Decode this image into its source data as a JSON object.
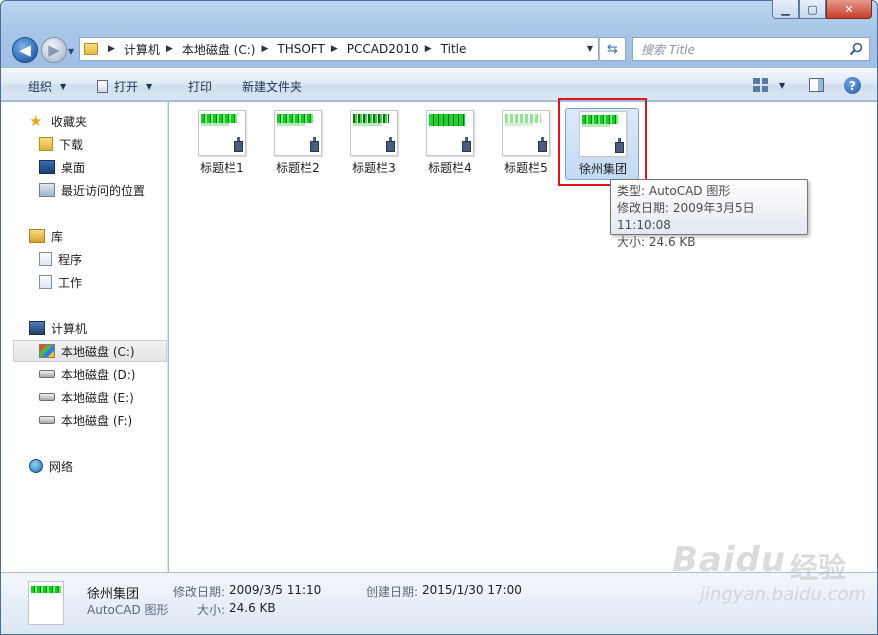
{
  "window": {
    "controls": {
      "minimize": "▁",
      "maximize": "▢",
      "close": "✕"
    }
  },
  "address": {
    "crumbs": [
      "计算机",
      "本地磁盘 (C:)",
      "THSOFT",
      "PCCAD2010",
      "Title"
    ]
  },
  "search": {
    "placeholder": "搜索 Title"
  },
  "toolbar": {
    "organize": "组织",
    "open": "打开",
    "print": "打印",
    "new_folder": "新建文件夹"
  },
  "nav": {
    "favorites": {
      "label": "收藏夹",
      "items": [
        {
          "label": "下载",
          "icon": "download-folder-icon"
        },
        {
          "label": "桌面",
          "icon": "desktop-icon"
        },
        {
          "label": "最近访问的位置",
          "icon": "recent-places-icon"
        }
      ]
    },
    "libraries": {
      "label": "库",
      "items": [
        {
          "label": "程序",
          "icon": "library-doc-icon"
        },
        {
          "label": "工作",
          "icon": "library-doc-icon"
        }
      ]
    },
    "computer": {
      "label": "计算机",
      "items": [
        {
          "label": "本地磁盘 (C:)",
          "icon": "windows-drive-icon",
          "selected": true
        },
        {
          "label": "本地磁盘 (D:)",
          "icon": "drive-icon"
        },
        {
          "label": "本地磁盘 (E:)",
          "icon": "drive-icon"
        },
        {
          "label": "本地磁盘 (F:)",
          "icon": "drive-icon"
        }
      ]
    },
    "network": {
      "label": "网络"
    }
  },
  "files": [
    {
      "name": "标题栏1"
    },
    {
      "name": "标题栏2"
    },
    {
      "name": "标题栏3"
    },
    {
      "name": "标题栏4"
    },
    {
      "name": "标题栏5"
    },
    {
      "name": "徐州集团",
      "selected": true
    }
  ],
  "tooltip": {
    "type": "类型: AutoCAD 图形",
    "modified": "修改日期: 2009年3月5日 11:10:08",
    "size": "大小: 24.6 KB"
  },
  "details": {
    "name": "徐州集团",
    "type": "AutoCAD 图形",
    "modified_label": "修改日期:",
    "modified_value": "2009/3/5 11:10",
    "size_label": "大小:",
    "size_value": "24.6 KB",
    "created_label": "创建日期:",
    "created_value": "2015/1/30 17:00"
  },
  "watermark": {
    "logo": "Baidu",
    "cn": "经验",
    "url": "jingyan.baidu.com"
  },
  "colors": {
    "accent": "#2a66b4",
    "highlight_box": "#e3111b",
    "selection": "#c2daf4"
  }
}
